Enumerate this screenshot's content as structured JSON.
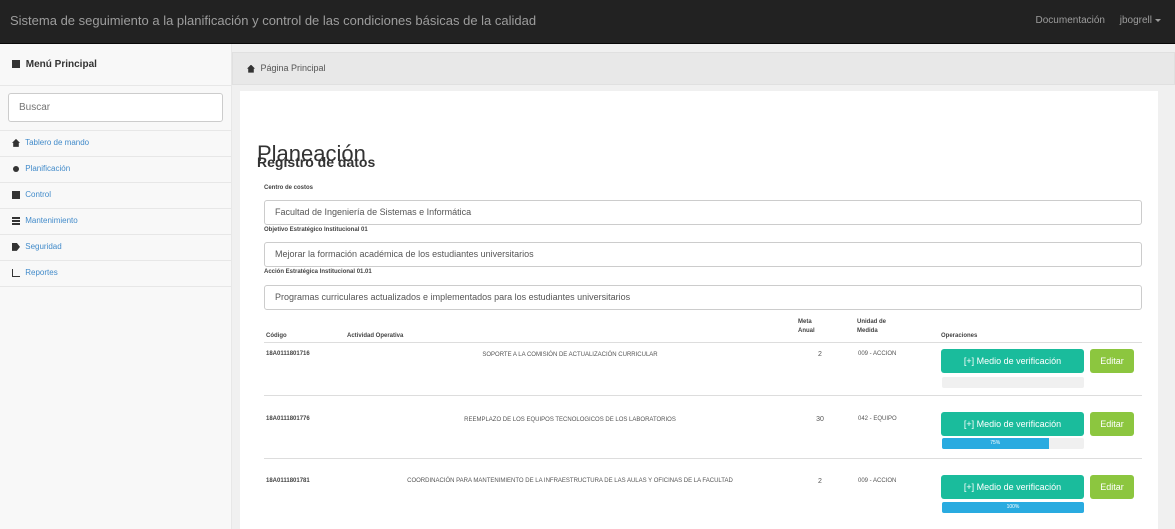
{
  "header": {
    "title": "Sistema de seguimiento a la planificación y control de las condiciones básicas de la calidad",
    "docs": "Documentación",
    "user": "jbogrell"
  },
  "sidebar": {
    "title": "Menú Principal",
    "search_placeholder": "Buscar",
    "items": [
      {
        "label": "Tablero de mando",
        "icon": "home-icon"
      },
      {
        "label": "Planificación",
        "icon": "circle-icon"
      },
      {
        "label": "Control",
        "icon": "grid-icon"
      },
      {
        "label": "Mantenimiento",
        "icon": "list-icon"
      },
      {
        "label": "Seguridad",
        "icon": "tag-icon"
      },
      {
        "label": "Reportes",
        "icon": "chart-icon"
      }
    ]
  },
  "breadcrumb": {
    "icon": "home-icon",
    "label": "Página Principal"
  },
  "main": {
    "title": "Planeación",
    "subtitle": "Registro de datos",
    "fields": [
      {
        "label": "Centro de costos",
        "value": "Facultad de Ingeniería de Sistemas e Informática"
      },
      {
        "label": "Objetivo Estratégico Institucional 01",
        "value": "Mejorar la formación académica de los estudiantes universitarios"
      },
      {
        "label": "Acción Estratégica Institucional 01.01",
        "value": "Programas curriculares actualizados e implementados para los estudiantes universitarios"
      }
    ],
    "table": {
      "headers": {
        "code": "Código",
        "activity": "Actividad Operativa",
        "goal": "Meta Anual",
        "unit": "Unidad de Medida",
        "ops": "Operaciones"
      },
      "rows": [
        {
          "code": "18A0111801716",
          "activity": "SOPORTE A LA COMISIÓN DE ACTUALIZACIÓN CURRICULAR",
          "goal": "2",
          "unit": "009 - ACCION",
          "progress": 0,
          "progress_label": ""
        },
        {
          "code": "18A0111801776",
          "activity": "REEMPLAZO DE LOS EQUIPOS TECNOLOGICOS DE LOS LABORATORIOS",
          "goal": "30",
          "unit": "042 - EQUIPO",
          "progress": 75,
          "progress_label": "75%"
        },
        {
          "code": "18A0111801781",
          "activity": "COORDINACIÓN PARA MANTENIMIENTO DE LA INFRAESTRUCTURA DE LAS AULAS Y OFICINAS DE LA FACULTAD",
          "goal": "2",
          "unit": "009 - ACCION",
          "progress": 100,
          "progress_label": "100%"
        }
      ],
      "verify_label": "[+] Medio de verificación",
      "edit_label": "Editar"
    }
  },
  "colors": {
    "topbar": "#222222",
    "verify_button": "#1abc9c",
    "edit_button": "#8cc63f",
    "progress": "#29abe0"
  }
}
